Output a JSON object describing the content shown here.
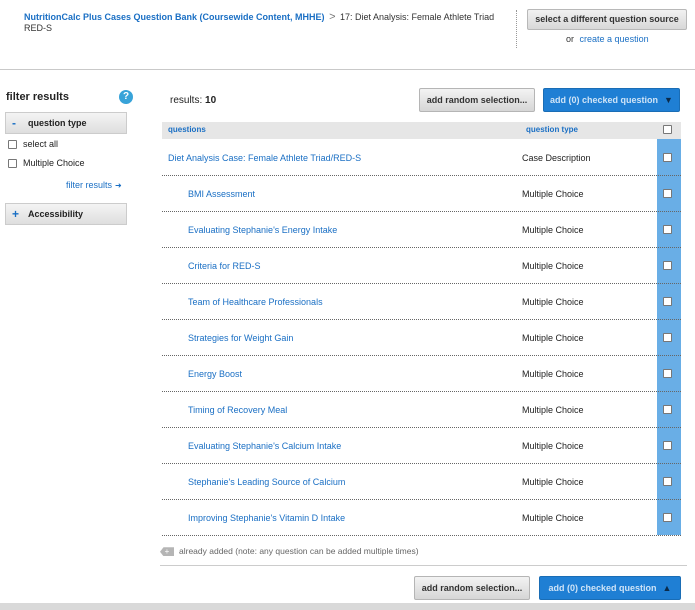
{
  "header": {
    "bank_link": "NutritionCalc Plus Cases Question Bank (Coursewide Content, MHHE)",
    "separator": ">",
    "current": "17: Diet Analysis: Female Athlete Triad",
    "current_sub": "RED-S",
    "select_source_label": "select a different question source",
    "or_text": "or",
    "create_link": "create a question"
  },
  "sidebar": {
    "title": "filter results",
    "help_icon": "?",
    "question_type_panel": {
      "symbol": "-",
      "label": "question type"
    },
    "options": [
      {
        "label": "select all",
        "checked": false
      },
      {
        "label": "Multiple Choice",
        "checked": false
      }
    ],
    "filter_link": "filter results",
    "accessibility_panel": {
      "symbol": "+",
      "label": "Accessibility"
    }
  },
  "main": {
    "results_label": "results:",
    "results_count": "10",
    "random_label": "add random selection...",
    "add_checked_label": "add (0) checked question",
    "columns": {
      "questions": "questions",
      "type": "question type"
    },
    "rows": [
      {
        "question": "Diet Analysis Case: Female Athlete Triad/RED-S",
        "type": "Case Description",
        "indent": false
      },
      {
        "question": "BMI Assessment",
        "type": "Multiple Choice",
        "indent": true
      },
      {
        "question": "Evaluating Stephanie's Energy Intake",
        "type": "Multiple Choice",
        "indent": true
      },
      {
        "question": "Criteria for RED-S",
        "type": "Multiple Choice",
        "indent": true
      },
      {
        "question": "Team of Healthcare Professionals",
        "type": "Multiple Choice",
        "indent": true
      },
      {
        "question": "Strategies for Weight Gain",
        "type": "Multiple Choice",
        "indent": true
      },
      {
        "question": "Energy Boost",
        "type": "Multiple Choice",
        "indent": true
      },
      {
        "question": "Timing of Recovery Meal",
        "type": "Multiple Choice",
        "indent": true
      },
      {
        "question": "Evaluating Stephanie's Calcium Intake",
        "type": "Multiple Choice",
        "indent": true
      },
      {
        "question": "Stephanie's Leading Source of Calcium",
        "type": "Multiple Choice",
        "indent": true
      },
      {
        "question": "Improving Stephanie's Vitamin D Intake",
        "type": "Multiple Choice",
        "indent": true
      }
    ],
    "already_added_note": "already added (note: any question can be added multiple times)",
    "bottom_random_label": "add random selection...",
    "bottom_add_label": "add (0) checked question"
  },
  "icons": {
    "down_arrow": "▼",
    "up_arrow": "▲",
    "right_arrow": "➜",
    "tag_plus": "+"
  },
  "colors": {
    "link": "#1a6fc4",
    "primary_button": "#1f7fd4",
    "checkbox_column": "#69aee6",
    "header_row": "#e6e6e6"
  }
}
